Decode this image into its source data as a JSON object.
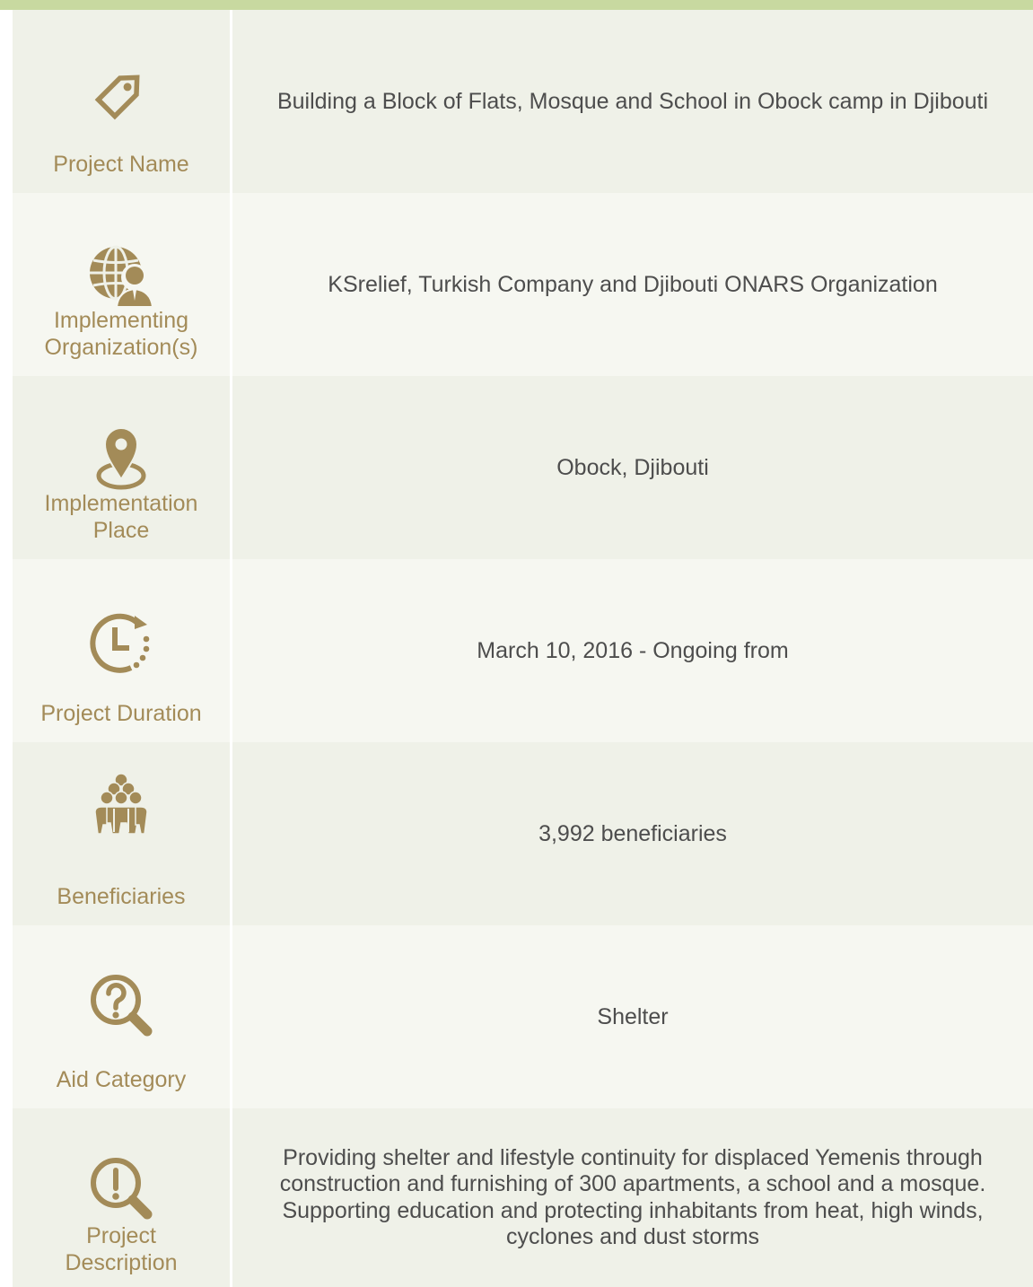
{
  "rows": [
    {
      "label": "Project Name",
      "value": "Building a Block of Flats, Mosque and School in Obock camp in Djibouti",
      "icon": "tag-icon"
    },
    {
      "label": "Implementing Organization(s)",
      "value": "KSrelief, Turkish Company and Djibouti ONARS Organization",
      "icon": "globe-person-icon"
    },
    {
      "label": "Implementation Place",
      "value": "Obock, Djibouti",
      "icon": "map-pin-icon"
    },
    {
      "label": "Project Duration",
      "value": "March 10, 2016 - Ongoing from",
      "icon": "clock-icon"
    },
    {
      "label": "Beneficiaries",
      "value": "3,992 beneficiaries",
      "icon": "people-group-icon"
    },
    {
      "label": "Aid Category",
      "value": "Shelter",
      "icon": "question-magnifier-icon"
    },
    {
      "label": "Project Description",
      "value": "Providing shelter and lifestyle continuity for displaced Yemenis through construction and furnishing of 300 apartments, a school and a mosque. Supporting education and protecting inhabitants from heat, high winds, cyclones and dust storms",
      "icon": "exclamation-magnifier-icon"
    }
  ],
  "colors": {
    "accent": "#a38b58",
    "top_bar": "#c8d9a0",
    "row_odd": "#eff1e8",
    "row_even": "#f6f7f1",
    "text": "#4d4d4d"
  }
}
